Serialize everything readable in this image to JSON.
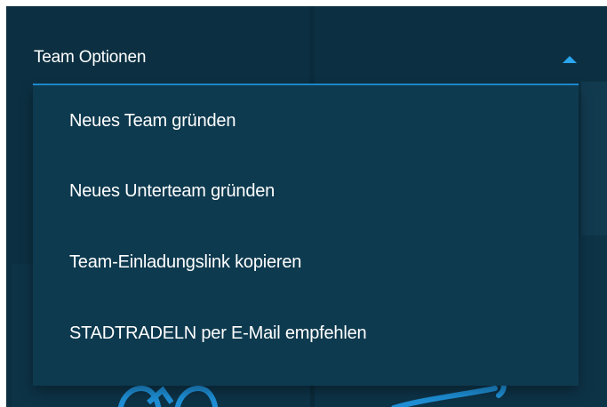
{
  "dropdown": {
    "label": "Team Optionen",
    "expanded": true,
    "accent_color": "#29a6ef",
    "background_color": "#0c3042",
    "menu_background_color": "#0e3a4f",
    "caret_icon": "caret-up-icon",
    "items": [
      {
        "label": "Neues Team gründen"
      },
      {
        "label": "Neues Unterteam gründen"
      },
      {
        "label": "Team-Einladungslink kopieren"
      },
      {
        "label": "STADTRADELN per E-Mail empfehlen"
      }
    ]
  }
}
